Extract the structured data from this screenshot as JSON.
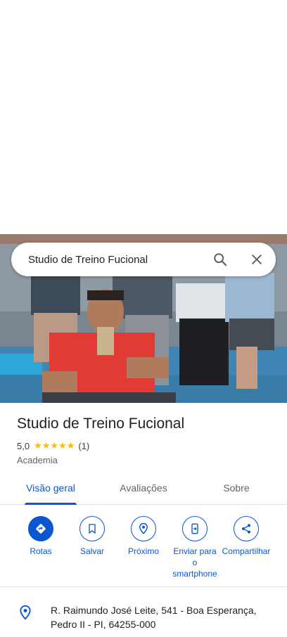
{
  "search": {
    "value": "Studio de Treino Fucional"
  },
  "place": {
    "name": "Studio de Treino Fucional",
    "rating": "5,0",
    "stars": "★★★★★",
    "review_count": "(1)",
    "category": "Academia",
    "address": "R. Raimundo José Leite, 541 - Boa Esperança, Pedro II - PI, 64255-000"
  },
  "tabs": [
    {
      "label": "Visão geral",
      "active": true
    },
    {
      "label": "Avaliações",
      "active": false
    },
    {
      "label": "Sobre",
      "active": false
    }
  ],
  "actions": [
    {
      "label": "Rotas",
      "icon": "directions-icon"
    },
    {
      "label": "Salvar",
      "icon": "bookmark-icon"
    },
    {
      "label": "Próximo",
      "icon": "nearby-icon"
    },
    {
      "label": "Enviar para o smartphone",
      "icon": "send-to-phone-icon"
    },
    {
      "label": "Compartilhar",
      "icon": "share-icon"
    }
  ],
  "colors": {
    "accent": "#0b57d0",
    "star": "#fbbc04",
    "text": "#202124",
    "secondary_text": "#5f6368"
  }
}
